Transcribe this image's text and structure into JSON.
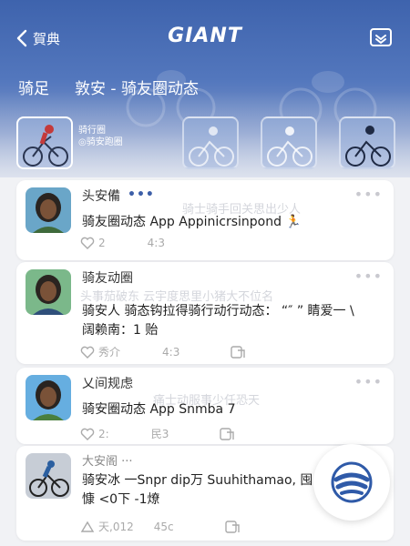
{
  "header": {
    "back_label": "賀典",
    "brand": "GIANT",
    "tabs": [
      "骑足",
      "敦安 - 骑友圈动态"
    ],
    "thumb_caption_line1": "骑行圈",
    "thumb_caption_line2": "◎骑安跑圈"
  },
  "posts": [
    {
      "author": "头安備",
      "author_suffix": "•••",
      "lines": [
        "骑友圈动态 App Appinicrsinpond 🏃"
      ],
      "ghost": "骑士骑手回关思出少人",
      "likes": "2",
      "count2": "4:3",
      "count3": ""
    },
    {
      "author": "骑友动圈",
      "author_suffix": "",
      "lines": [
        "骑安人  骑态钩拉得骑行动行动态：  “″ ” 睛爱一 \\",
        "阔赖南：1 贻"
      ],
      "ghost": "头事茄破东   云宇度思里小猪大不位名",
      "likes": "秀介",
      "count2": "4:3",
      "count3": ""
    },
    {
      "author": "乂间规虑",
      "author_suffix": "",
      "lines": [
        "骑安圈动态 App Snmba 7"
      ],
      "ghost": "痛士动服事少任恐天",
      "likes": "2:",
      "count2": "民3",
      "count3": ""
    },
    {
      "author": "大安阁 ···",
      "author_suffix": "",
      "lines": [
        "骑安冰 一Snpr dip万 Suuhithamao,    囤",
        "慷 <0下 -1燎"
      ],
      "ghost": "",
      "likes": "天,012",
      "count2": "45c",
      "count3": ""
    }
  ],
  "colors": {
    "header_blue": "#3e63ad",
    "accent": "#3d5fa8",
    "fab_logo": "#2f5aa8"
  }
}
